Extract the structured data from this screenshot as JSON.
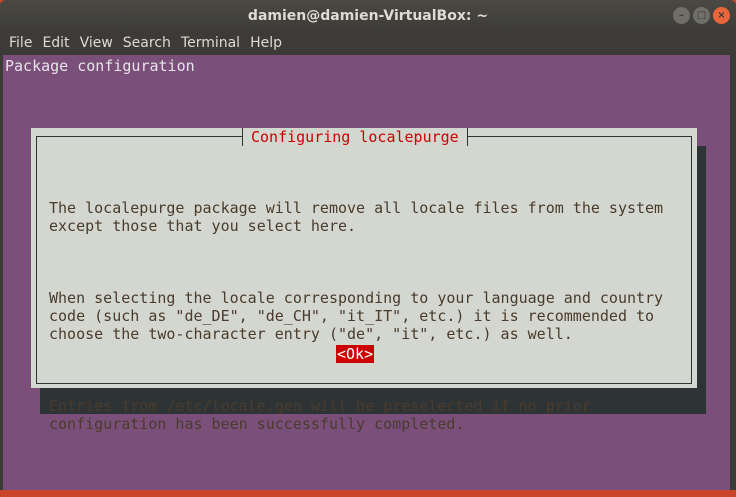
{
  "window": {
    "title": "damien@damien-VirtualBox: ~",
    "controls": [
      "minimize",
      "maximize",
      "close"
    ]
  },
  "menu": [
    "File",
    "Edit",
    "View",
    "Search",
    "Terminal",
    "Help"
  ],
  "terminal": {
    "header": "Package configuration"
  },
  "dialog": {
    "title": "Configuring localepurge",
    "paragraphs": [
      "The localepurge package will remove all locale files from the system\nexcept those that you select here.",
      "When selecting the locale corresponding to your language and country\ncode (such as \"de_DE\", \"de_CH\", \"it_IT\", etc.) it is recommended to\nchoose the two-character entry (\"de\", \"it\", etc.) as well.",
      "Entries from /etc/locale.gen will be preselected if no prior\nconfiguration has been successfully completed."
    ],
    "ok_label": "<Ok>"
  }
}
